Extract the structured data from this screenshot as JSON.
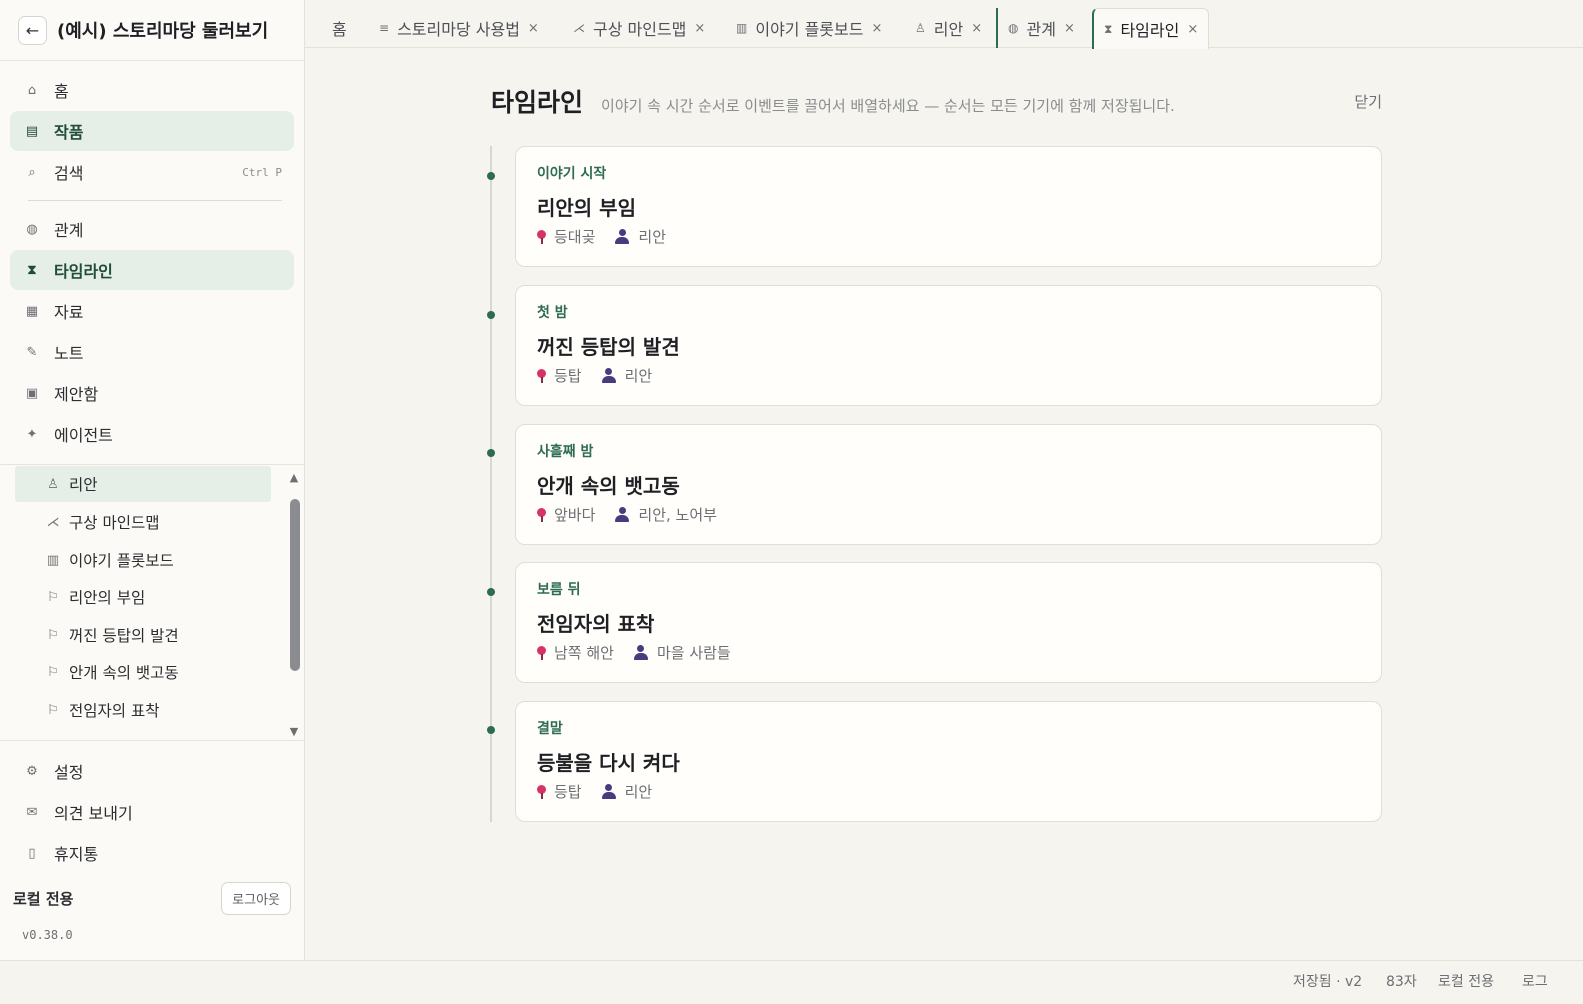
{
  "sidebar": {
    "back_icon": "arrow-left-icon",
    "project_title": "(예시) 스토리마당 둘러보기",
    "nav": [
      {
        "label": "홈",
        "icon": "home-icon"
      },
      {
        "label": "작품",
        "icon": "list-icon"
      },
      {
        "label": "검색",
        "icon": "search-icon",
        "shortcut": "Ctrl P"
      },
      {
        "label": "관계",
        "icon": "network-icon"
      },
      {
        "label": "타임라인",
        "icon": "hourglass-icon"
      },
      {
        "label": "자료",
        "icon": "grid-icon"
      },
      {
        "label": "노트",
        "icon": "pencil-icon"
      },
      {
        "label": "제안함",
        "icon": "inbox-icon"
      },
      {
        "label": "에이전트",
        "icon": "sparkle-icon"
      }
    ],
    "tree": [
      {
        "label": "리안",
        "icon": "person-icon"
      },
      {
        "label": "구상 마인드맵",
        "icon": "mindmap-icon"
      },
      {
        "label": "이야기 플롯보드",
        "icon": "board-icon"
      },
      {
        "label": "리안의 부임",
        "icon": "flag-icon"
      },
      {
        "label": "꺼진 등탑의 발견",
        "icon": "flag-icon"
      },
      {
        "label": "안개 속의 뱃고동",
        "icon": "flag-icon"
      },
      {
        "label": "전임자의 표착",
        "icon": "flag-icon"
      }
    ],
    "footer_nav": [
      {
        "label": "설정",
        "icon": "gear-icon"
      },
      {
        "label": "의견 보내기",
        "icon": "mail-icon"
      },
      {
        "label": "휴지통",
        "icon": "trash-icon"
      }
    ],
    "account_label": "로컬 전용",
    "logout_label": "로그아웃",
    "version": "v0.38.0"
  },
  "tabs": [
    {
      "label": "홈",
      "icon": ""
    },
    {
      "label": "스토리마당 사용법",
      "icon": "document-icon"
    },
    {
      "label": "구상 마인드맵",
      "icon": "mindmap-icon"
    },
    {
      "label": "이야기 플롯보드",
      "icon": "board-icon"
    },
    {
      "label": "리안",
      "icon": "person-icon"
    },
    {
      "label": "관계",
      "icon": "network-icon"
    },
    {
      "label": "타임라인",
      "icon": "hourglass-icon"
    }
  ],
  "main": {
    "title": "타임라인",
    "subtitle": "이야기 속 시간 순서로 이벤트를 끌어서 배열하세요 — 순서는 모든 기기에 함께 저장됩니다.",
    "close_label": "닫기",
    "events": [
      {
        "time": "이야기 시작",
        "title": "리안의 부임",
        "place": "등대곶",
        "people": "리안"
      },
      {
        "time": "첫 밤",
        "title": "꺼진 등탑의 발견",
        "place": "등탑",
        "people": "리안"
      },
      {
        "time": "사흘째 밤",
        "title": "안개 속의 뱃고동",
        "place": "앞바다",
        "people": "리안, 노어부"
      },
      {
        "time": "보름 뒤",
        "title": "전임자의 표착",
        "place": "남쪽 해안",
        "people": "마을 사람들"
      },
      {
        "time": "결말",
        "title": "등불을 다시 켜다",
        "place": "등탑",
        "people": "리안"
      }
    ]
  },
  "statusbar": {
    "saved": "저장됨 · v2",
    "chars": "83자",
    "mode": "로컬 전용",
    "log": "로그"
  },
  "colors": {
    "accent": "#2e6b52",
    "active_bg": "#e5efe7",
    "pin": "#d63462",
    "person": "#4a3a80"
  }
}
